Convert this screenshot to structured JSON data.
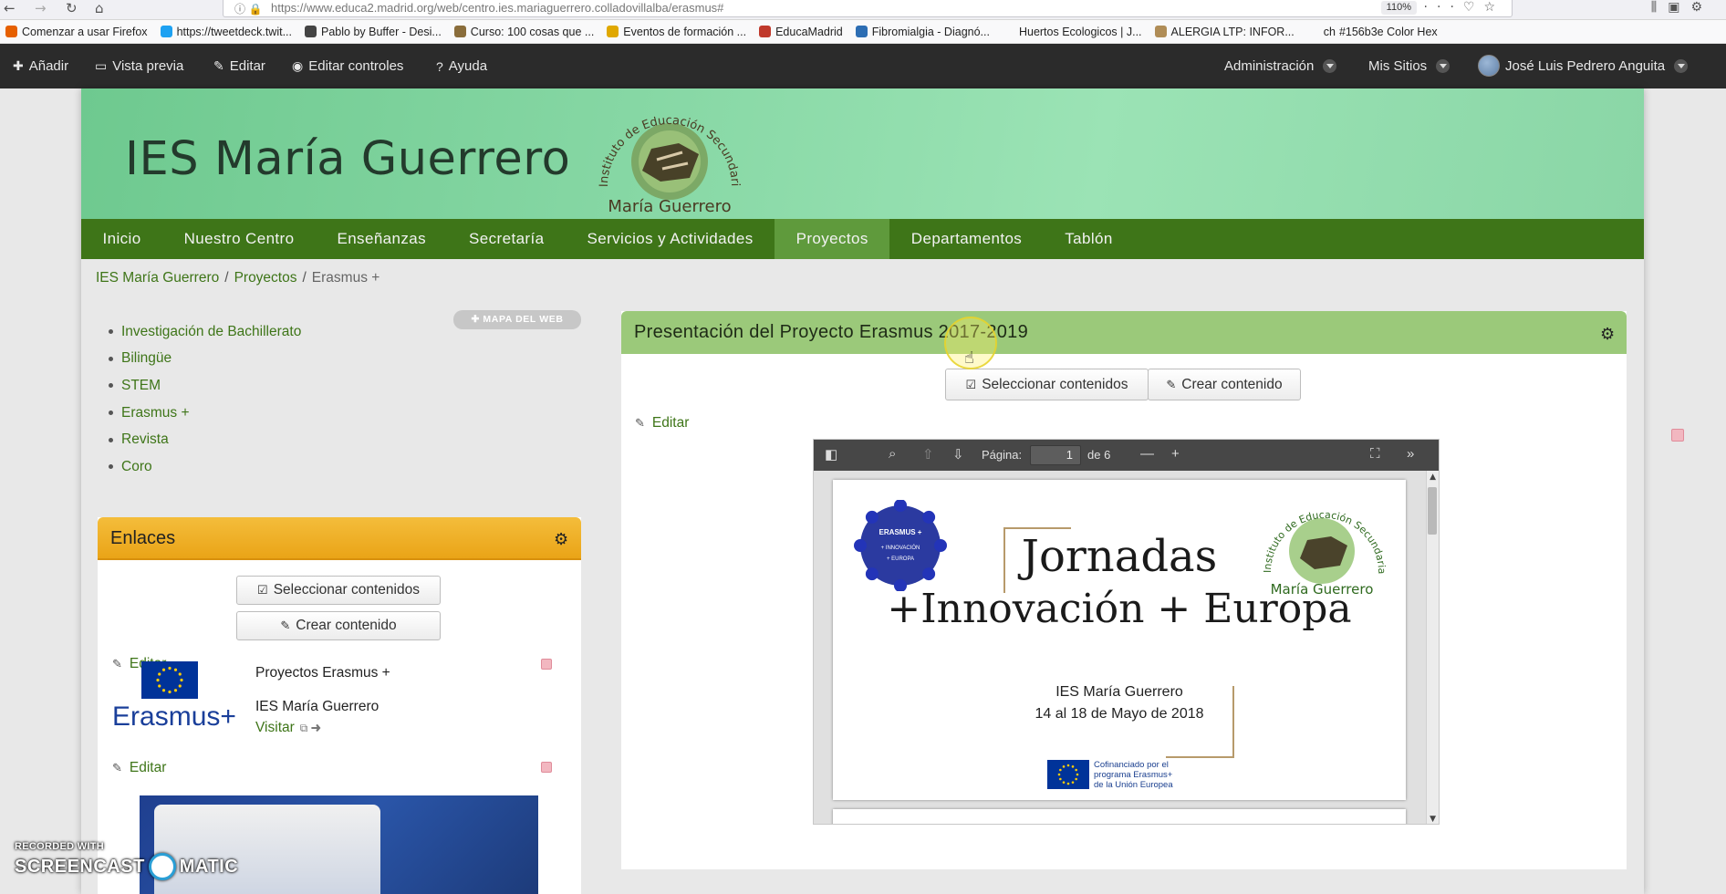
{
  "browser": {
    "url": "https://www.educa2.madrid.org/web/centro.ies.mariaguerrero.colladovillalba/erasmus#",
    "zoom": "110%",
    "bookmarks": [
      {
        "label": "Comenzar a usar Firefox",
        "icon": "firefox-icon",
        "color": "#e66000"
      },
      {
        "label": "https://tweetdeck.twit...",
        "icon": "tweetdeck-icon",
        "color": "#1da1f2"
      },
      {
        "label": "Pablo by Buffer - Desi...",
        "icon": "buffer-icon",
        "color": "#444444"
      },
      {
        "label": "Curso: 100 cosas que ...",
        "icon": "course-icon",
        "color": "#8a6d3b"
      },
      {
        "label": "Eventos de formación ...",
        "icon": "events-icon",
        "color": "#e0a800"
      },
      {
        "label": "EducaMadrid",
        "icon": "educamadrid-icon",
        "color": "#c0392b"
      },
      {
        "label": "Fibromialgia - Diagnó...",
        "icon": "fibro-icon",
        "color": "#2c6db3"
      },
      {
        "label": "Huertos Ecologicos | J...",
        "icon": "huertos-icon",
        "color": "#f9f9fa"
      },
      {
        "label": "ALERGIA LTP: INFOR...",
        "icon": "alergia-icon",
        "color": "#b08d57"
      },
      {
        "label": "#156b3e Color Hex",
        "icon": "colorhex-icon",
        "color": "#f9f9fa",
        "prefix": "ch"
      }
    ]
  },
  "adminbar": {
    "add": "Añadir",
    "preview": "Vista previa",
    "edit": "Editar",
    "edit_controls": "Editar controles",
    "help": "Ayuda",
    "admin": "Administración",
    "my_sites": "Mis Sitios",
    "user": "José Luis Pedrero Anguita"
  },
  "site": {
    "title": "IES María Guerrero",
    "logo_arc_text": "Instituto de Educación Secundaria",
    "logo_name": "María Guerrero"
  },
  "nav": [
    {
      "label": "Inicio",
      "active": false
    },
    {
      "label": "Nuestro Centro",
      "active": false
    },
    {
      "label": "Enseñanzas",
      "active": false
    },
    {
      "label": "Secretaría",
      "active": false
    },
    {
      "label": "Servicios y Actividades",
      "active": false
    },
    {
      "label": "Proyectos",
      "active": true
    },
    {
      "label": "Departamentos",
      "active": false
    },
    {
      "label": "Tablón",
      "active": false
    }
  ],
  "breadcrumb": [
    "IES María Guerrero",
    "Proyectos",
    "Erasmus +"
  ],
  "sitemap_button": "MAPA DEL WEB",
  "sidebar_links": [
    "Investigación de Bachillerato",
    "Bilingüe",
    "STEM",
    "Erasmus +",
    "Revista",
    "Coro"
  ],
  "enlaces": {
    "title": "Enlaces",
    "select_contents": "Seleccionar contenidos",
    "create_content": "Crear contenido",
    "edit": "Editar",
    "erasmus_word": "Erasmus+",
    "item_title": "Proyectos Erasmus +",
    "item_subtitle": "IES María Guerrero",
    "visit": "Visitar",
    "edit2": "Editar"
  },
  "main": {
    "title": "Presentación del Proyecto Erasmus 2017-2019",
    "select_contents": "Seleccionar contenidos",
    "create_content": "Crear contenido",
    "edit": "Editar"
  },
  "pdf": {
    "page_label": "Página:",
    "page_current": "1",
    "page_total": "de 6",
    "badge_lines": [
      "ERASMUS +",
      "+ INNOVACIÓN",
      "+ EUROPA"
    ],
    "heading1": "Jornadas",
    "heading2": "+Innovación + Europa",
    "school": "IES María Guerrero",
    "dates": "14 al 18 de Mayo de 2018",
    "cofin_lines": [
      "Cofinanciado por el",
      "programa Erasmus+",
      "de la Unión Europea"
    ],
    "logo_arc_text": "Instituto de Educación Secundaria",
    "logo_name": "María Guerrero"
  },
  "watermark": {
    "line1": "RECORDED WITH",
    "left": "SCREENCAST",
    "right": "MATIC"
  },
  "colors": {
    "nav_green": "#3e7518",
    "nav_active": "#5f9a3c",
    "enlaces_orange": "#eaa417",
    "main_head": "#9bc97a",
    "admin_dark": "#2b2b2b"
  }
}
